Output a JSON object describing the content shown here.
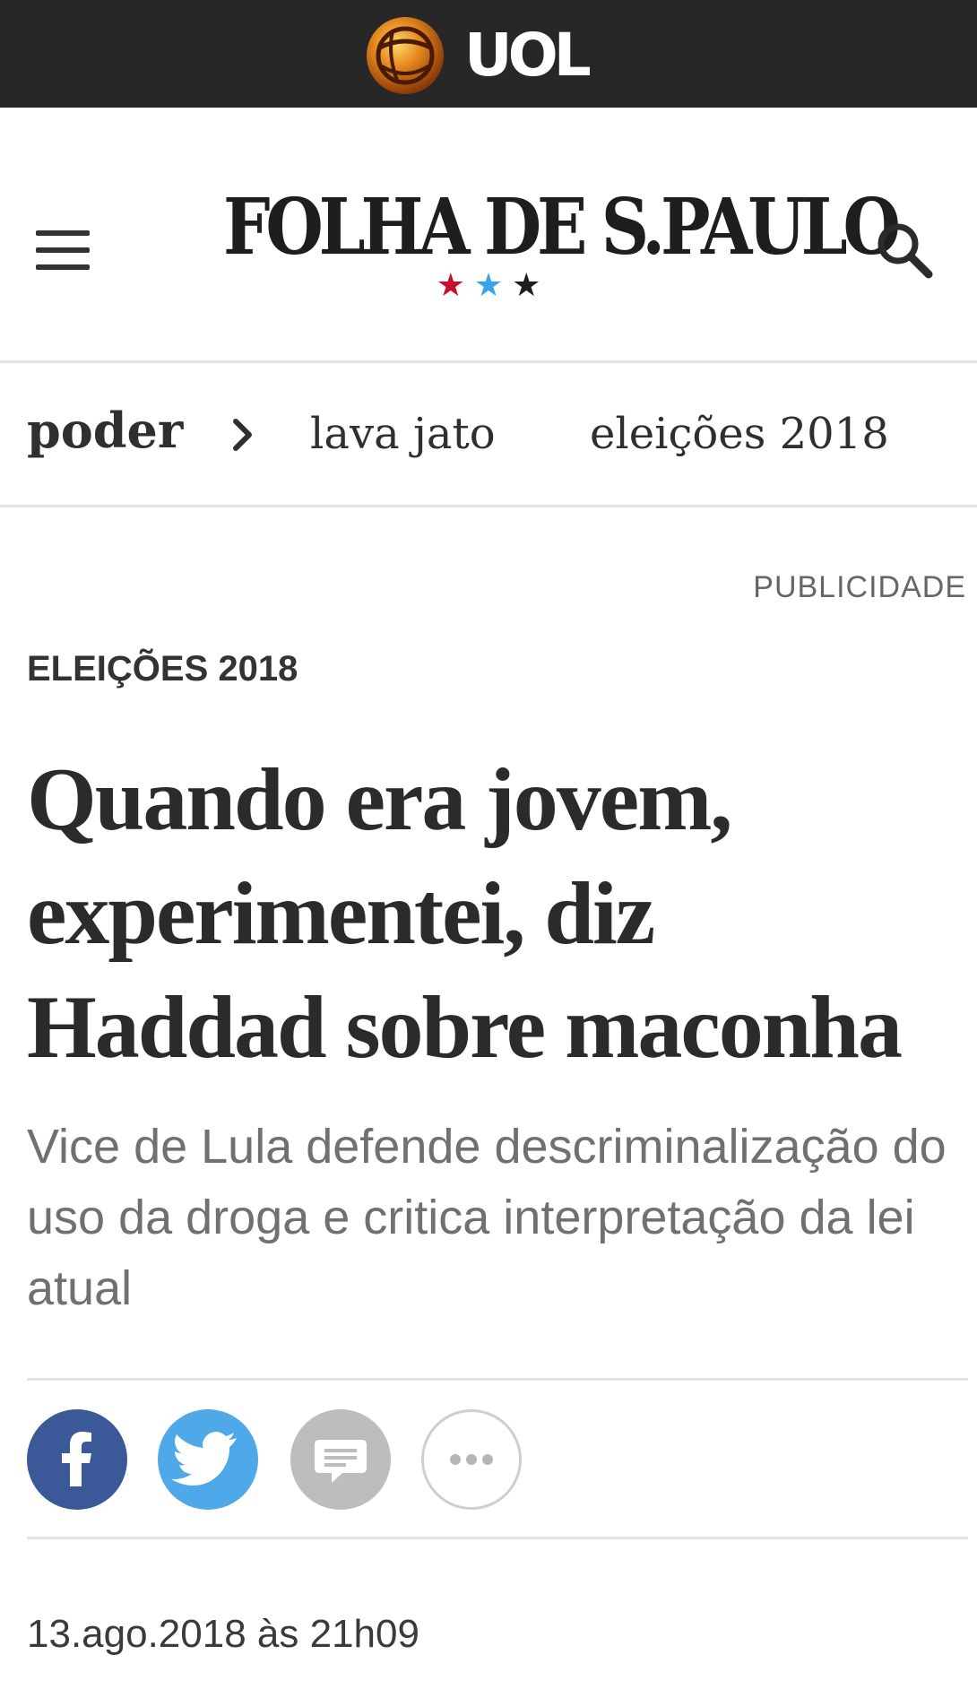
{
  "topbar": {
    "logo_text": "UOL",
    "background": "#272727"
  },
  "header": {
    "brand": "FOLHA DE S.PAULO",
    "stars": [
      "★",
      "★",
      "★"
    ],
    "star_colors": [
      "#c8102e",
      "#3aa3e6",
      "#1e1e1e"
    ],
    "menu_icon": "hamburger-menu-icon",
    "search_icon": "search-icon"
  },
  "nav": {
    "section": "poder",
    "chevron_icon": "chevron-right-icon",
    "links": [
      "lava jato",
      "eleições 2018"
    ]
  },
  "article": {
    "publicidade": "PUBLICIDADE",
    "kicker": "ELEIÇÕES 2018",
    "headline": "Quando era jovem, experimentei, diz Haddad sobre maconha",
    "subtitle": "Vice de Lula defende descriminalização do uso da droga e critica interpretação da lei atual",
    "date": "13.ago.2018 às 21h09"
  },
  "share": {
    "buttons": [
      {
        "icon": "facebook-icon",
        "color": "#3b5998"
      },
      {
        "icon": "twitter-icon",
        "color": "#4fa8e8"
      },
      {
        "icon": "comments-icon",
        "color": "#bdbdbd"
      },
      {
        "icon": "more-icon",
        "color": "#ffffff"
      }
    ]
  }
}
